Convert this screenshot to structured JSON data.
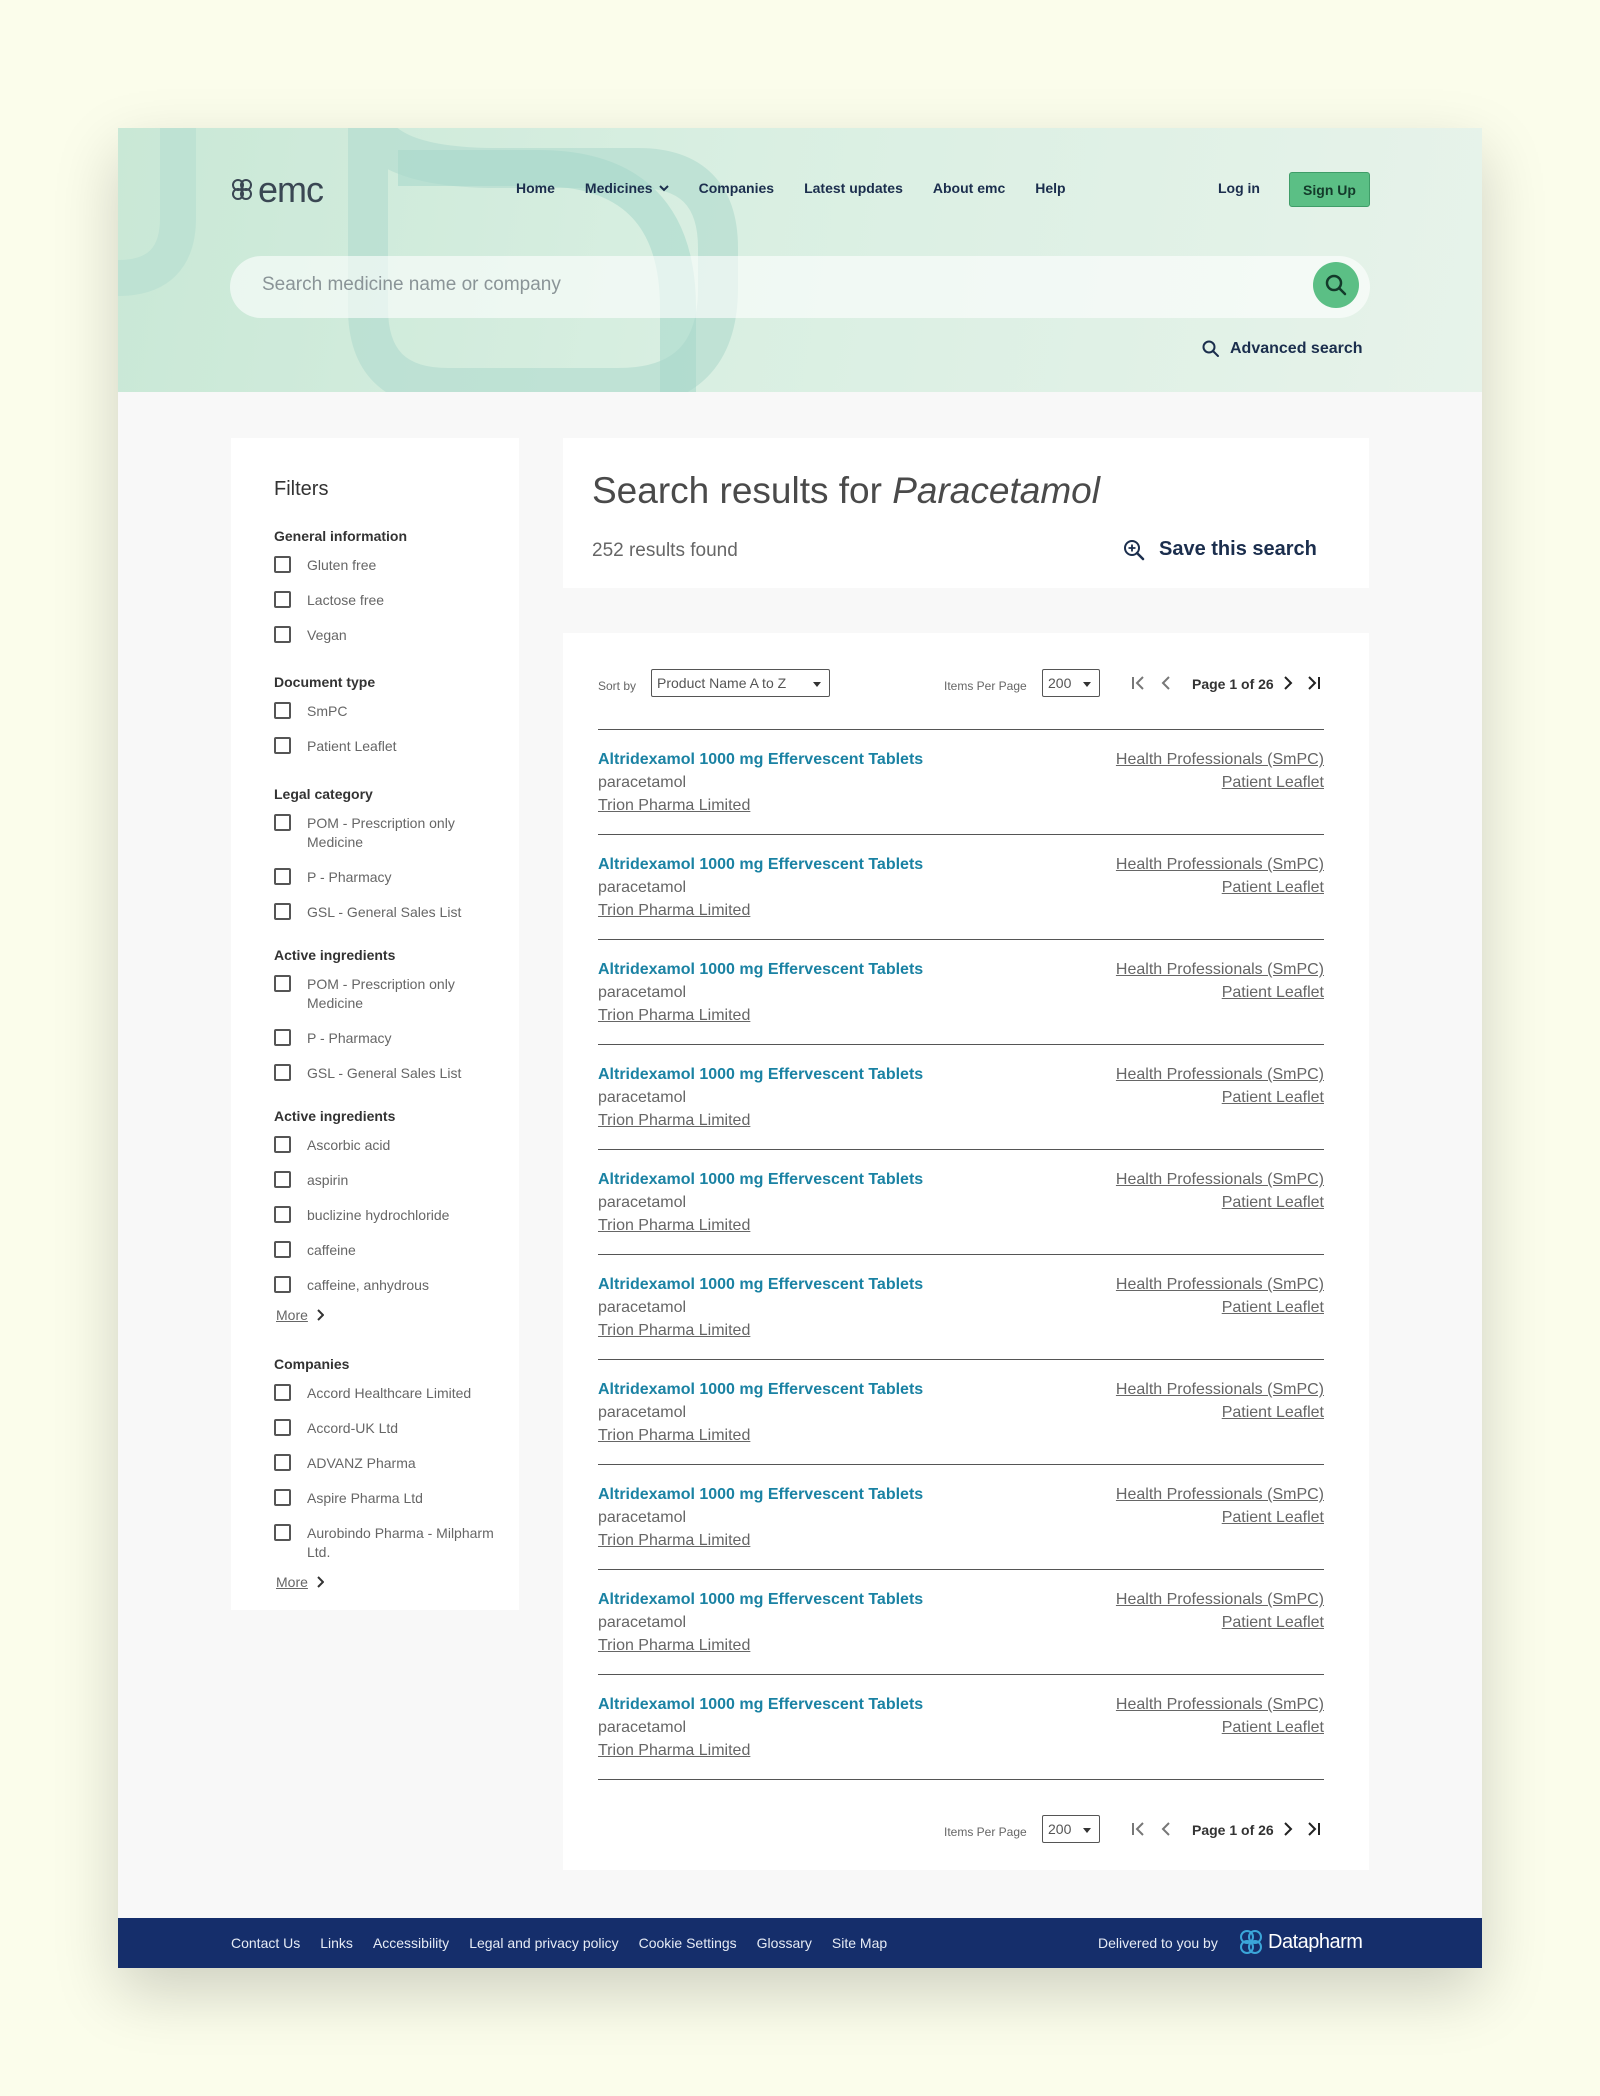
{
  "header": {
    "logo_text": "emc",
    "nav": [
      "Home",
      "Medicines",
      "Companies",
      "Latest updates",
      "About emc",
      "Help"
    ],
    "login": "Log in",
    "signup": "Sign Up",
    "search_placeholder": "Search medicine name or company",
    "advanced_search": "Advanced search"
  },
  "filters": {
    "title": "Filters",
    "sections": [
      {
        "title": "General information",
        "options": [
          "Gluten free",
          "Lactose free",
          "Vegan"
        ]
      },
      {
        "title": "Document type",
        "options": [
          "SmPC",
          "Patient Leaflet"
        ]
      },
      {
        "title": "Legal category",
        "options": [
          "POM - Prescription only Medicine",
          "P - Pharmacy",
          "GSL - General Sales List"
        ]
      },
      {
        "title": "Active ingredients",
        "options": [
          "POM - Prescription only Medicine",
          "P - Pharmacy",
          "GSL - General Sales List"
        ]
      },
      {
        "title": "Active ingredients",
        "options": [
          "Ascorbic acid",
          "aspirin",
          "buclizine hydrochloride",
          "caffeine",
          "caffeine, anhydrous"
        ],
        "more": "More"
      },
      {
        "title": "Companies",
        "options": [
          "Accord Healthcare Limited",
          "Accord-UK Ltd",
          "ADVANZ Pharma",
          "Aspire Pharma Ltd",
          "Aurobindo Pharma - Milpharm Ltd."
        ],
        "more": "More"
      }
    ]
  },
  "results_header": {
    "title_prefix": "Search results for",
    "query": "Paracetamol",
    "count": "252 results found",
    "save": "Save this search"
  },
  "pagination": {
    "sort_label": "Sort by",
    "sort_value": "Product Name A to Z",
    "ipp_label": "Items Per Page",
    "ipp_value": "200",
    "page_label": "Page 1 of 26"
  },
  "results": [
    {
      "name": "Altridexamol 1000 mg Effervescent Tablets",
      "ingredient": "paracetamol",
      "company": "Trion Pharma Limited",
      "smpc": "Health Professionals (SmPC)",
      "leaflet": "Patient Leaflet"
    },
    {
      "name": "Altridexamol 1000 mg Effervescent Tablets",
      "ingredient": "paracetamol",
      "company": "Trion Pharma Limited",
      "smpc": "Health Professionals (SmPC)",
      "leaflet": "Patient Leaflet"
    },
    {
      "name": "Altridexamol 1000 mg Effervescent Tablets",
      "ingredient": "paracetamol",
      "company": "Trion Pharma Limited",
      "smpc": "Health Professionals (SmPC)",
      "leaflet": "Patient Leaflet"
    },
    {
      "name": "Altridexamol 1000 mg Effervescent Tablets",
      "ingredient": "paracetamol",
      "company": "Trion Pharma Limited",
      "smpc": "Health Professionals (SmPC)",
      "leaflet": "Patient Leaflet"
    },
    {
      "name": "Altridexamol 1000 mg Effervescent Tablets",
      "ingredient": "paracetamol",
      "company": "Trion Pharma Limited",
      "smpc": "Health Professionals (SmPC)",
      "leaflet": "Patient Leaflet"
    },
    {
      "name": "Altridexamol 1000 mg Effervescent Tablets",
      "ingredient": "paracetamol",
      "company": "Trion Pharma Limited",
      "smpc": "Health Professionals (SmPC)",
      "leaflet": "Patient Leaflet"
    },
    {
      "name": "Altridexamol 1000 mg Effervescent Tablets",
      "ingredient": "paracetamol",
      "company": "Trion Pharma Limited",
      "smpc": "Health Professionals (SmPC)",
      "leaflet": "Patient Leaflet"
    },
    {
      "name": "Altridexamol 1000 mg Effervescent Tablets",
      "ingredient": "paracetamol",
      "company": "Trion Pharma Limited",
      "smpc": "Health Professionals (SmPC)",
      "leaflet": "Patient Leaflet"
    },
    {
      "name": "Altridexamol 1000 mg Effervescent Tablets",
      "ingredient": "paracetamol",
      "company": "Trion Pharma Limited",
      "smpc": "Health Professionals (SmPC)",
      "leaflet": "Patient Leaflet"
    },
    {
      "name": "Altridexamol 1000 mg Effervescent Tablets",
      "ingredient": "paracetamol",
      "company": "Trion Pharma Limited",
      "smpc": "Health Professionals (SmPC)",
      "leaflet": "Patient Leaflet"
    }
  ],
  "footer": {
    "links": [
      "Contact Us",
      "Links",
      "Accessibility",
      "Legal and privacy policy",
      "Cookie Settings",
      "Glossary",
      "Site Map"
    ],
    "delivered_by": "Delivered to you by",
    "brand": "Datapharm"
  },
  "colors": {
    "accent_green": "#5bbf85",
    "navy": "#152e6b",
    "link_blue": "#1a82a3"
  }
}
